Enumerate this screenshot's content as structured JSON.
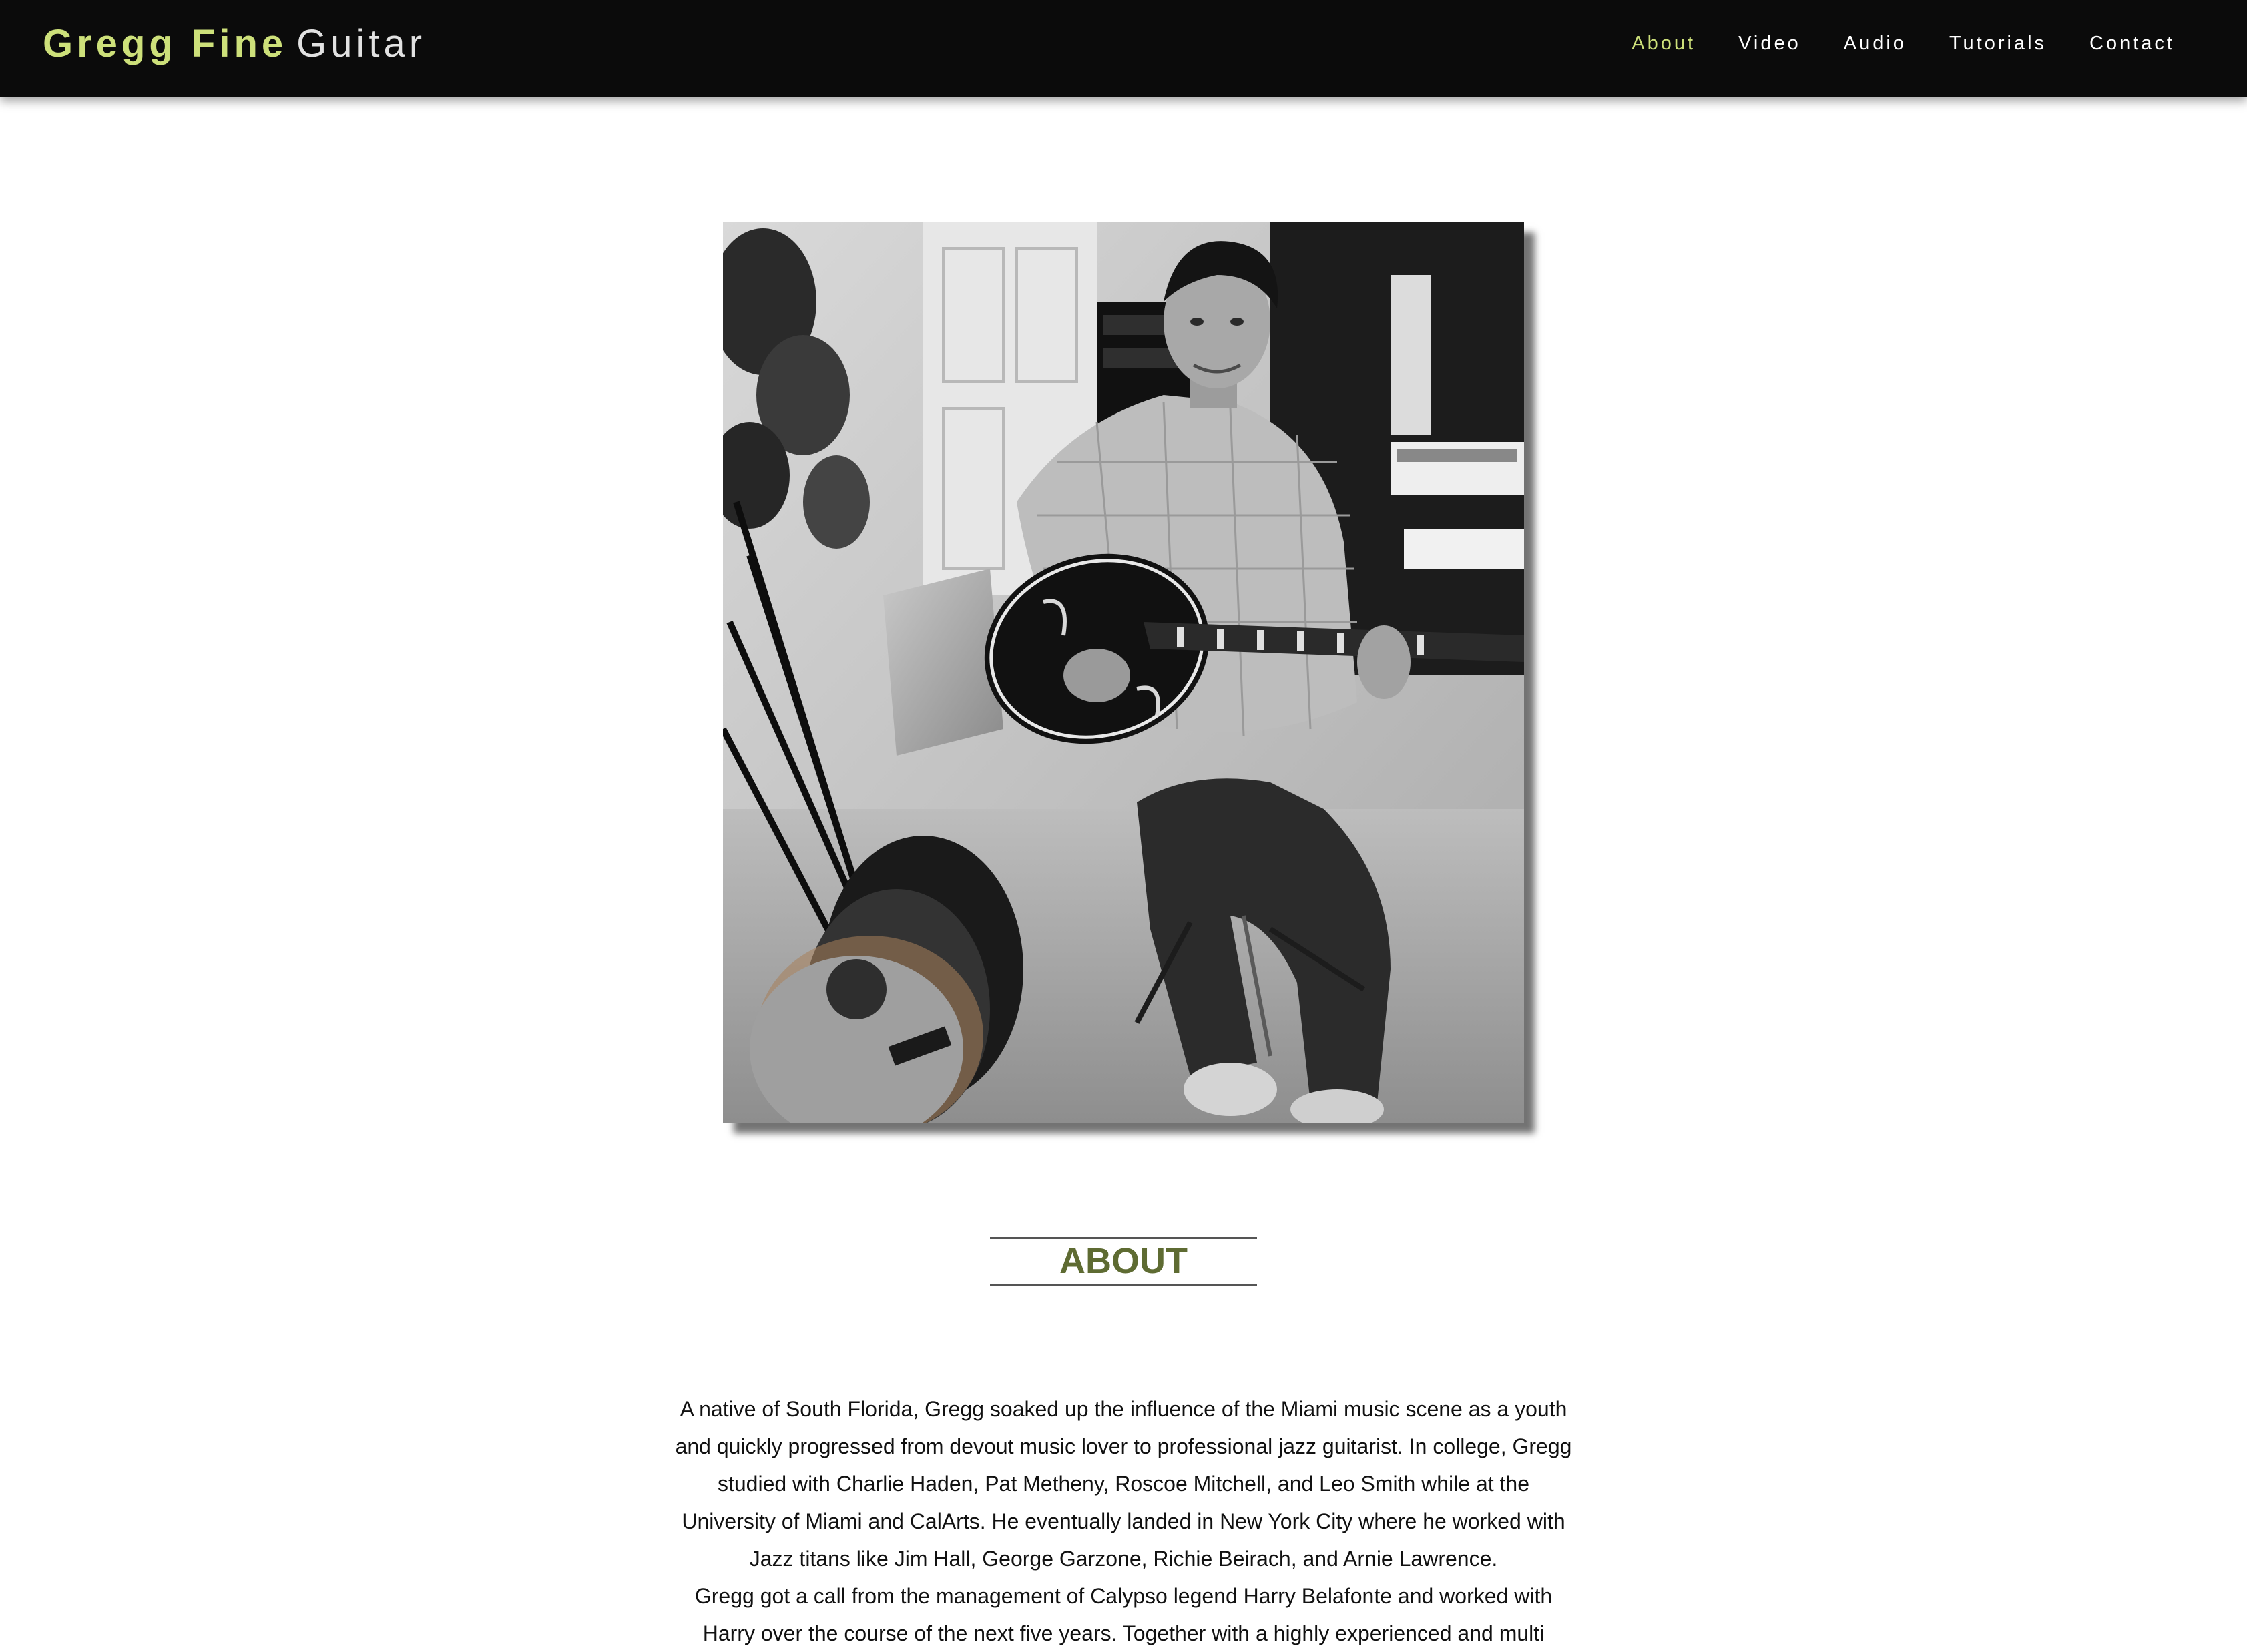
{
  "brand": {
    "name": "Gregg Fine",
    "subtitle": "Guitar"
  },
  "nav": {
    "items": [
      {
        "label": "About",
        "active": true
      },
      {
        "label": "Video",
        "active": false
      },
      {
        "label": "Audio",
        "active": false
      },
      {
        "label": "Tutorials",
        "active": false
      },
      {
        "label": "Contact",
        "active": false
      }
    ]
  },
  "colors": {
    "accent": "#cde07a",
    "heading": "#5e6b32",
    "navbar_bg": "#0b0b0b"
  },
  "about": {
    "title": "ABOUT",
    "paragraphs": [
      "A native of South Florida, Gregg soaked up the influence of the Miami music scene as a youth and quickly progressed from devout music lover to professional jazz guitarist. In college, Gregg studied with Charlie Haden, Pat Metheny, Roscoe Mitchell, and Leo Smith while at the University of Miami and CalArts. He eventually landed in New York City where he worked with Jazz titans like Jim Hall, George Garzone, Richie Beirach, and Arnie Lawrence.",
      "Gregg got a call from the management of Calypso legend Harry Belafonte and worked with Harry over the course of the next five years. Together with a highly experienced and multi"
    ]
  }
}
